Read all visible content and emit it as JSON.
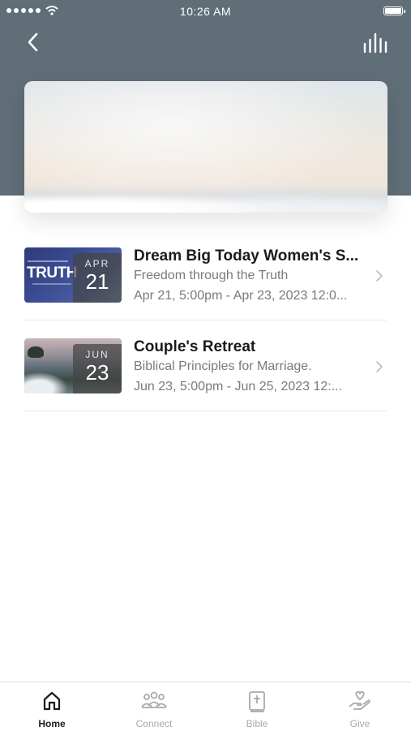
{
  "status_bar": {
    "time": "10:26 AM"
  },
  "header": {
    "back_icon": "chevron-left-icon",
    "stats_icon": "bar-chart-icon"
  },
  "events": [
    {
      "title": "Dream Big Today Women's S...",
      "subtitle": "Freedom through the Truth",
      "dates": "Apr 21, 5:00pm - Apr 23, 2023 12:0...",
      "month": "APR",
      "day": "21",
      "thumb_text": "TRUTH"
    },
    {
      "title": "Couple's Retreat",
      "subtitle": "Biblical Principles for Marriage.",
      "dates": "Jun 23, 5:00pm - Jun 25, 2023 12:...",
      "month": "JUN",
      "day": "23"
    }
  ],
  "tabs": [
    {
      "label": "Home",
      "icon": "home-icon",
      "active": true
    },
    {
      "label": "Connect",
      "icon": "people-icon",
      "active": false
    },
    {
      "label": "Bible",
      "icon": "bible-icon",
      "active": false
    },
    {
      "label": "Give",
      "icon": "give-icon",
      "active": false
    }
  ],
  "colors": {
    "header_bg": "#5f6e77",
    "muted_text": "#7a7a7a",
    "tab_inactive": "#a9a9a9"
  }
}
